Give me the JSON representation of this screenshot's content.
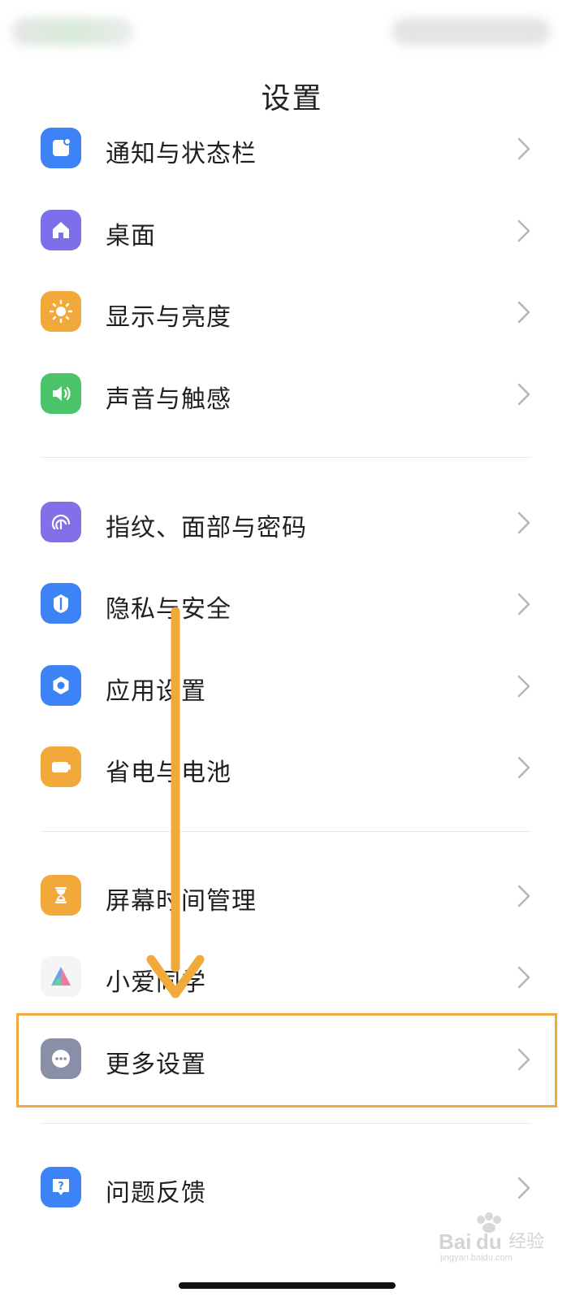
{
  "header": {
    "title": "设置"
  },
  "sections": [
    {
      "items": [
        {
          "label": "通知与状态栏",
          "icon": "notification-icon",
          "color": "#3d82f6"
        },
        {
          "label": "桌面",
          "icon": "home-icon",
          "color": "#7c70ea"
        },
        {
          "label": "显示与亮度",
          "icon": "sun-icon",
          "color": "#f3a93a"
        },
        {
          "label": "声音与触感",
          "icon": "speaker-icon",
          "color": "#4cc46a"
        }
      ]
    },
    {
      "items": [
        {
          "label": "指纹、面部与密码",
          "icon": "fingerprint-icon",
          "color": "#8470e6"
        },
        {
          "label": "隐私与安全",
          "icon": "shield-icon",
          "color": "#3d82f6"
        },
        {
          "label": "应用设置",
          "icon": "gear-icon",
          "color": "#3d82f6"
        },
        {
          "label": "省电与电池",
          "icon": "battery-icon",
          "color": "#f3a93a"
        }
      ]
    },
    {
      "items": [
        {
          "label": "屏幕时间管理",
          "icon": "hourglass-icon",
          "color": "#f3a93a"
        },
        {
          "label": "小爱同学",
          "icon": "xiaoai-icon",
          "color": "#f5f5f5"
        },
        {
          "label": "更多设置",
          "icon": "more-icon",
          "color": "#8a8fa8"
        }
      ]
    },
    {
      "items": [
        {
          "label": "问题反馈",
          "icon": "feedback-icon",
          "color": "#3d82f6"
        }
      ]
    }
  ],
  "annotation": {
    "highlight_color": "#f2a93b",
    "arrow_color": "#f2a93b"
  },
  "watermark": {
    "logo_text": "Bai du 经验",
    "url_text": "jingyan.baidu.com"
  }
}
